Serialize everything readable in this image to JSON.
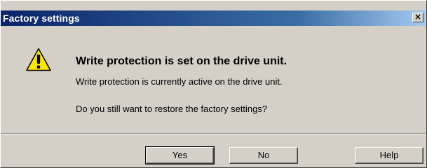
{
  "window": {
    "title": "Factory settings",
    "close_label": "×"
  },
  "message": {
    "icon": "warning-icon",
    "headline": "Write protection is set on the drive unit.",
    "line1": "Write protection is currently active on the drive unit.",
    "line2": "Do you still want to restore the factory settings?"
  },
  "buttons": {
    "yes": "Yes",
    "no": "No",
    "help": "Help"
  },
  "colors": {
    "titlebar_start": "#0a246a",
    "titlebar_end": "#a6caf0",
    "dialog_face": "#d4d0c8",
    "warning_fill": "#ffe600"
  }
}
